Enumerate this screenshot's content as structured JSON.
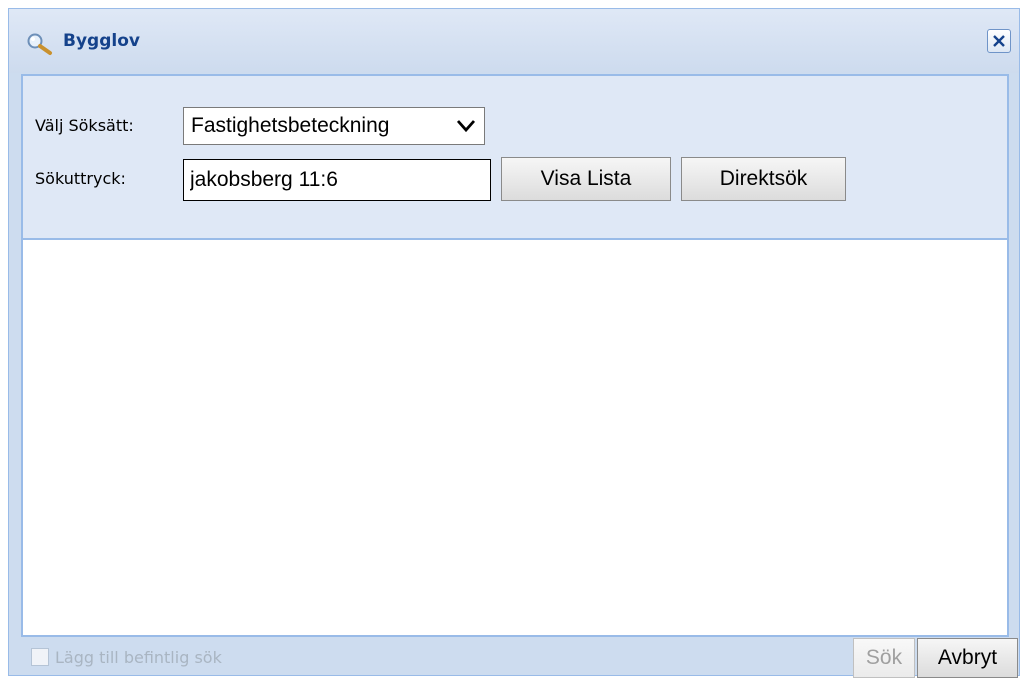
{
  "window": {
    "title": "Bygglov",
    "title_icon": "search-icon",
    "close_icon": "close-icon"
  },
  "form": {
    "search_method_label": "Välj Söksätt:",
    "search_method_value": "Fastighetsbeteckning",
    "search_expression_label": "Sökuttryck:",
    "search_expression_value": "jakobsberg 11:6",
    "show_list_label": "Visa Lista",
    "direct_search_label": "Direktsök"
  },
  "footer": {
    "append_checkbox_label": "Lägg till befintlig sök",
    "append_checkbox_checked": false,
    "append_checkbox_enabled": false,
    "search_button_label": "Sök",
    "search_button_enabled": false,
    "cancel_button_label": "Avbryt"
  },
  "colors": {
    "title_text": "#15428b",
    "panel_border": "#99bbe8",
    "panel_background": "#dfe8f6"
  }
}
